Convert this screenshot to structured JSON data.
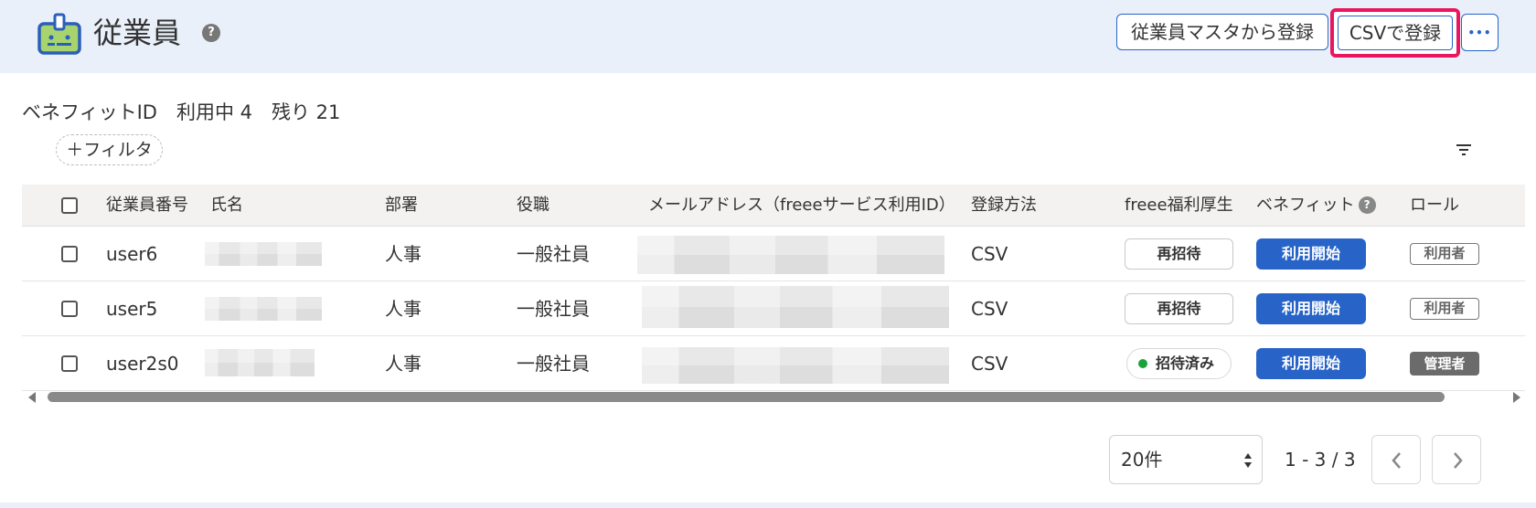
{
  "header": {
    "title": "従業員",
    "help_icon": "question-circle-icon",
    "register_from_master_label": "従業員マスタから登録",
    "register_csv_label": "CSVで登録",
    "more_label": "•••",
    "highlight_color": "#e8175d",
    "accent_color": "#2864c8"
  },
  "summary": {
    "text": "ベネフィットID　利用中 4　残り 21"
  },
  "filter": {
    "add_label": "＋フィルタ",
    "sort_icon": "filter-lines-icon"
  },
  "table": {
    "columns": {
      "employee_no": "従業員番号",
      "name": "氏名",
      "department": "部署",
      "position": "役職",
      "email": "メールアドレス（freeeサービス利用ID）",
      "registration": "登録方法",
      "welfare": "freee福利厚生",
      "benefit": "ベネフィット",
      "role": "ロール"
    },
    "rows": [
      {
        "employee_no": "user6",
        "department": "人事",
        "position": "一般社員",
        "registration": "CSV",
        "welfare": "再招待",
        "benefit": "利用開始",
        "role": "利用者"
      },
      {
        "employee_no": "user5",
        "department": "人事",
        "position": "一般社員",
        "registration": "CSV",
        "welfare": "再招待",
        "benefit": "利用開始",
        "role": "利用者"
      },
      {
        "employee_no": "user2s0",
        "department": "人事",
        "position": "一般社員",
        "registration": "CSV",
        "welfare": "招待済み",
        "benefit": "利用開始",
        "role": "管理者"
      }
    ]
  },
  "pagination": {
    "per_page": "20件",
    "range": "1 - 3 / 3"
  }
}
